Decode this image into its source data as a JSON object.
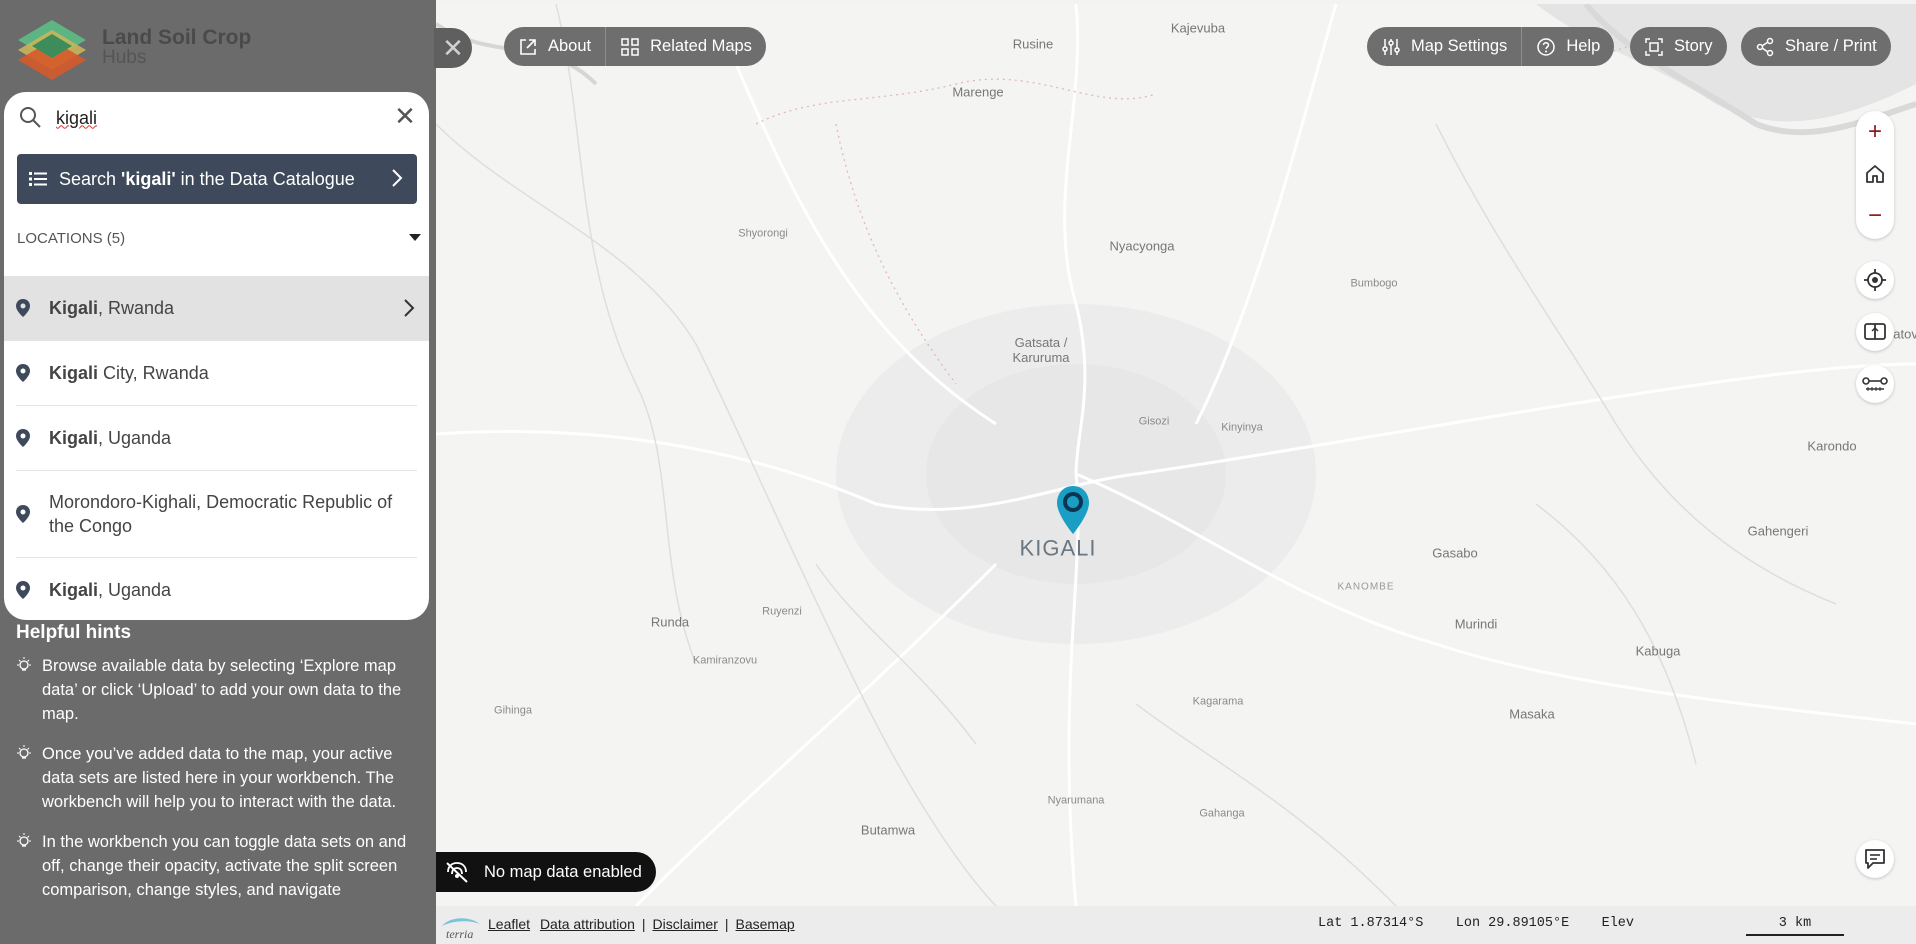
{
  "brand": {
    "title": "Land Soil Crop",
    "subtitle": "Hubs"
  },
  "search": {
    "value": "kigali",
    "catalogue_prefix": "Search ",
    "catalogue_query": "'kigali'",
    "catalogue_suffix": " in the Data Catalogue"
  },
  "locations": {
    "header": "LOCATIONS (5)",
    "items": [
      {
        "bold": "Kigali",
        "rest": ", Rwanda"
      },
      {
        "bold": "Kigali",
        "rest": " City, Rwanda"
      },
      {
        "bold": "Kigali",
        "rest": ", Uganda"
      },
      {
        "bold": "",
        "rest": "Morondoro-Kighali, Democratic Republic of the Congo"
      },
      {
        "bold": "Kigali",
        "rest": ", Uganda"
      }
    ]
  },
  "hints": {
    "title": "Helpful hints",
    "items": [
      "Browse available data by selecting ‘Explore map data’ or click ‘Upload’ to add your own data to the map.",
      "Once you’ve added data to the map, your active data sets are listed here in your workbench. The workbench will help you to interact with the data.",
      "In the workbench you can toggle data sets on and off, change their opacity, activate the split screen comparison, change styles, and navigate"
    ]
  },
  "toolbar": {
    "about": "About",
    "related_maps": "Related Maps",
    "map_settings": "Map Settings",
    "help": "Help",
    "story": "Story",
    "share_print": "Share / Print"
  },
  "map": {
    "marker_label": "KIGALI",
    "places": [
      "Kajevuba",
      "Rusine",
      "Marenge",
      "Shyorongi",
      "Nyacyonga",
      "Bumbogo",
      "Gatsata / Karuruma",
      "Gisozi",
      "Kinyinya",
      "Nyagatovu",
      "Karondo",
      "Gahengeri",
      "Gasabo",
      "KANOMBE",
      "Murindi",
      "Kabuga",
      "Runda",
      "Ruyenzi",
      "Kamiranzovu",
      "Gihinga",
      "Kagarama",
      "Masaka",
      "Nyarumana",
      "Gahanga",
      "Butamwa"
    ],
    "no_data": "No map data enabled"
  },
  "footer": {
    "links": [
      "Leaflet",
      "Data attribution",
      "Disclaimer",
      "Basemap"
    ],
    "lat_label": "Lat",
    "lat": "1.87314°S",
    "lon_label": "Lon",
    "lon": "29.89105°E",
    "elev_label": "Elev",
    "scale": "3 km"
  },
  "colors": {
    "sidebar": "#6b6b6b",
    "catalogue_btn": "#3e4a5c",
    "marker": "#1a9ec4",
    "zoom": "#8b1a1a"
  }
}
